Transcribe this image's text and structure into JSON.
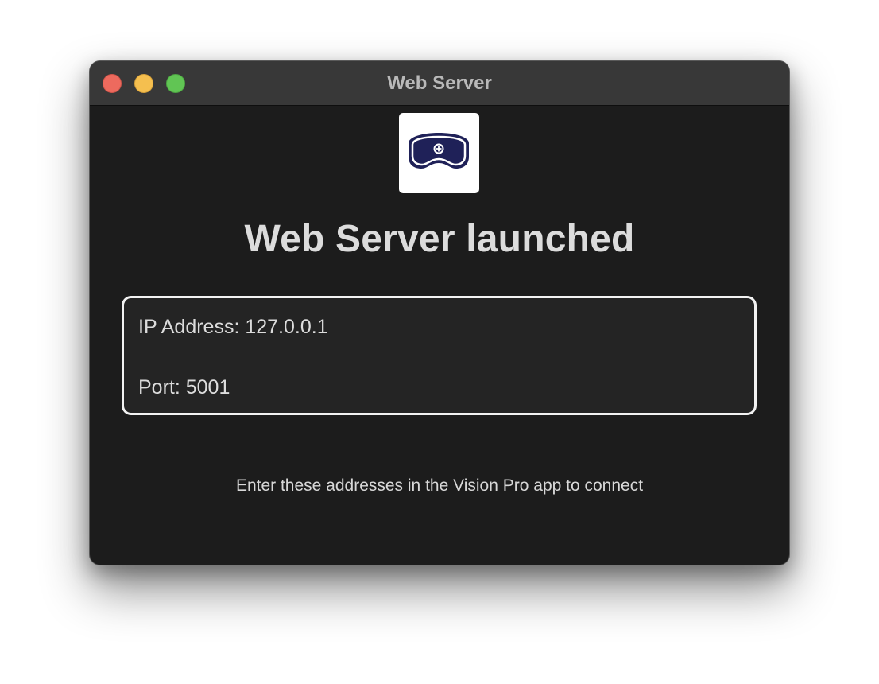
{
  "window": {
    "title": "Web Server"
  },
  "traffic_lights": {
    "close": "close-button",
    "minimize": "minimize-button",
    "zoom": "zoom-button"
  },
  "app_icon": {
    "name": "vision-headset-icon",
    "colors": {
      "background": "#ffffff",
      "headset": "#1f2158",
      "accent": "#ffffff"
    }
  },
  "main": {
    "headline": "Web Server launched",
    "ip_line": "IP Address: 127.0.0.1",
    "port_line": "Port: 5001",
    "instruction": "Enter these addresses in the Vision Pro app to connect"
  },
  "colors": {
    "window_bg": "#1c1c1c",
    "titlebar_bg": "#383838",
    "text": "#dcdcdc",
    "box_border": "#f2f2f2",
    "close": "#ed6a5e",
    "minimize": "#f5bf4f",
    "zoom": "#61c554"
  }
}
